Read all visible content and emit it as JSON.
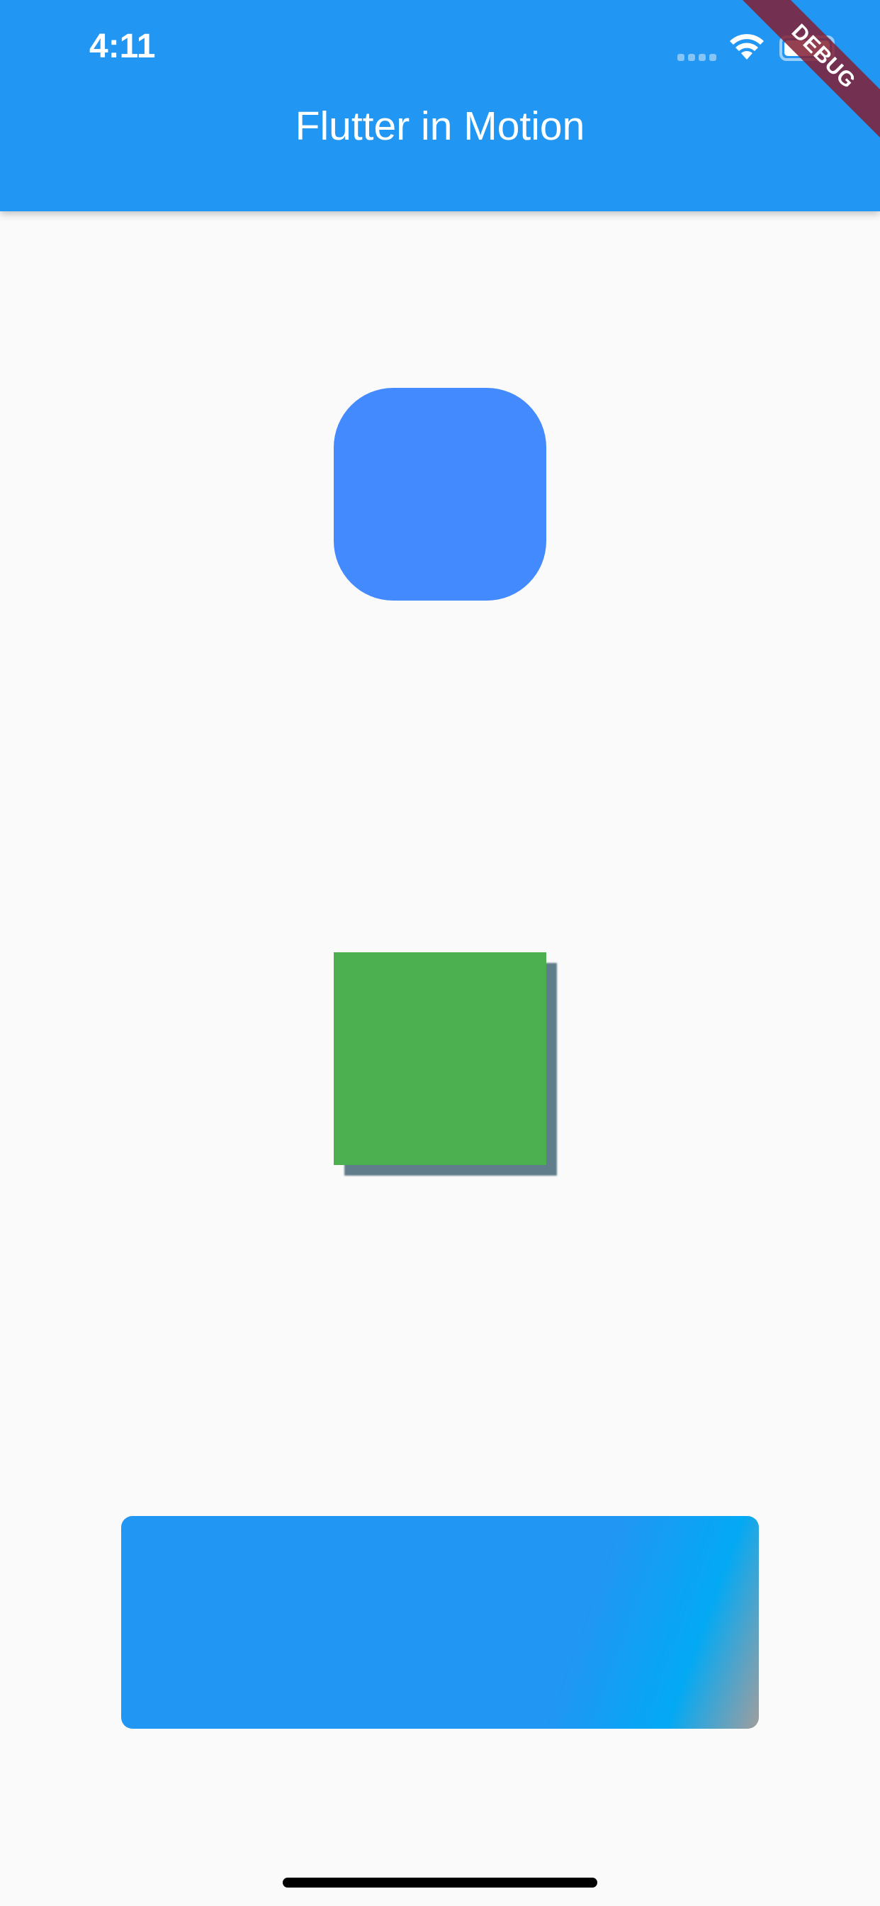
{
  "status_bar": {
    "time": "4:11",
    "signal_icon": "signal-dots-icon",
    "wifi_icon": "wifi-icon",
    "battery_icon": "battery-icon"
  },
  "app_bar": {
    "title": "Flutter in Motion",
    "color": "#2196F3"
  },
  "debug_banner": {
    "label": "DEBUG",
    "color": "#8B1E3F"
  },
  "shapes": {
    "rounded_box_color": "#448AFF",
    "square_color": "#4CAF50",
    "square_shadow_color": "#607D8B",
    "gradient_colors": [
      "#2196F3",
      "#03A9F4",
      "#9E9E9E"
    ]
  },
  "background_color": "#FAFAFA"
}
